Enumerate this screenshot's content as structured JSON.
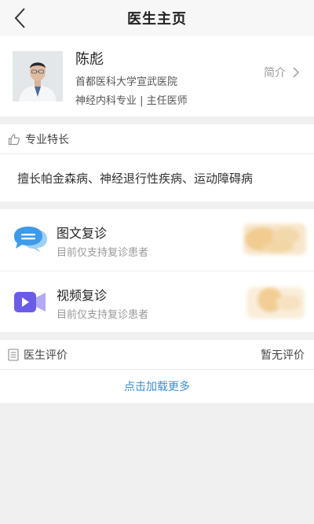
{
  "navbar": {
    "title": "医生主页",
    "back_icon": "chevron-left-icon"
  },
  "doctor": {
    "name": "陈彪",
    "hospital": "首都医科大学宣武医院",
    "department_title": "神经内科专业 | 主任医师",
    "intro_label": "简介"
  },
  "specialty": {
    "header": "专业特长",
    "icon": "thumbs-up-icon",
    "text": "擅长帕金森病、神经退行性疾病、运动障碍病"
  },
  "services": [
    {
      "title": "图文复诊",
      "subtitle": "目前仅支持复诊患者",
      "icon": "chat-bubble-icon",
      "icon_color": "#3d9be9"
    },
    {
      "title": "视频复诊",
      "subtitle": "目前仅支持复诊患者",
      "icon": "video-camera-icon",
      "icon_color": "#6b5ce7"
    }
  ],
  "reviews": {
    "header": "医生评价",
    "icon": "document-list-icon",
    "status": "暂无评价",
    "load_more": "点击加载更多"
  },
  "colors": {
    "accent": "#3a8fd6",
    "background": "#f0f0f0"
  }
}
